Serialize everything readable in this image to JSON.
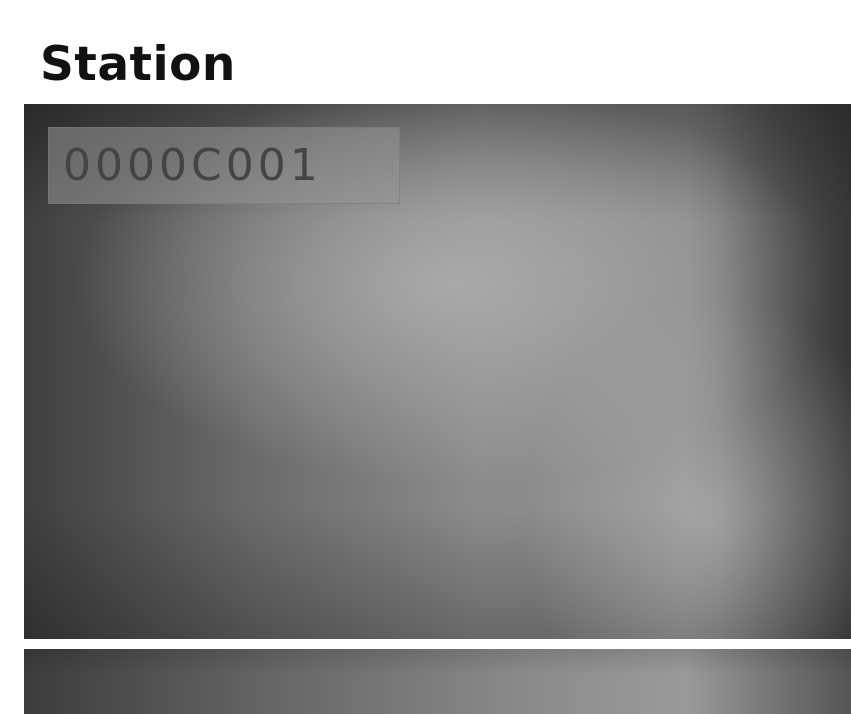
{
  "page": {
    "title": "Station"
  },
  "screen": {
    "station_id": "0000C001"
  }
}
